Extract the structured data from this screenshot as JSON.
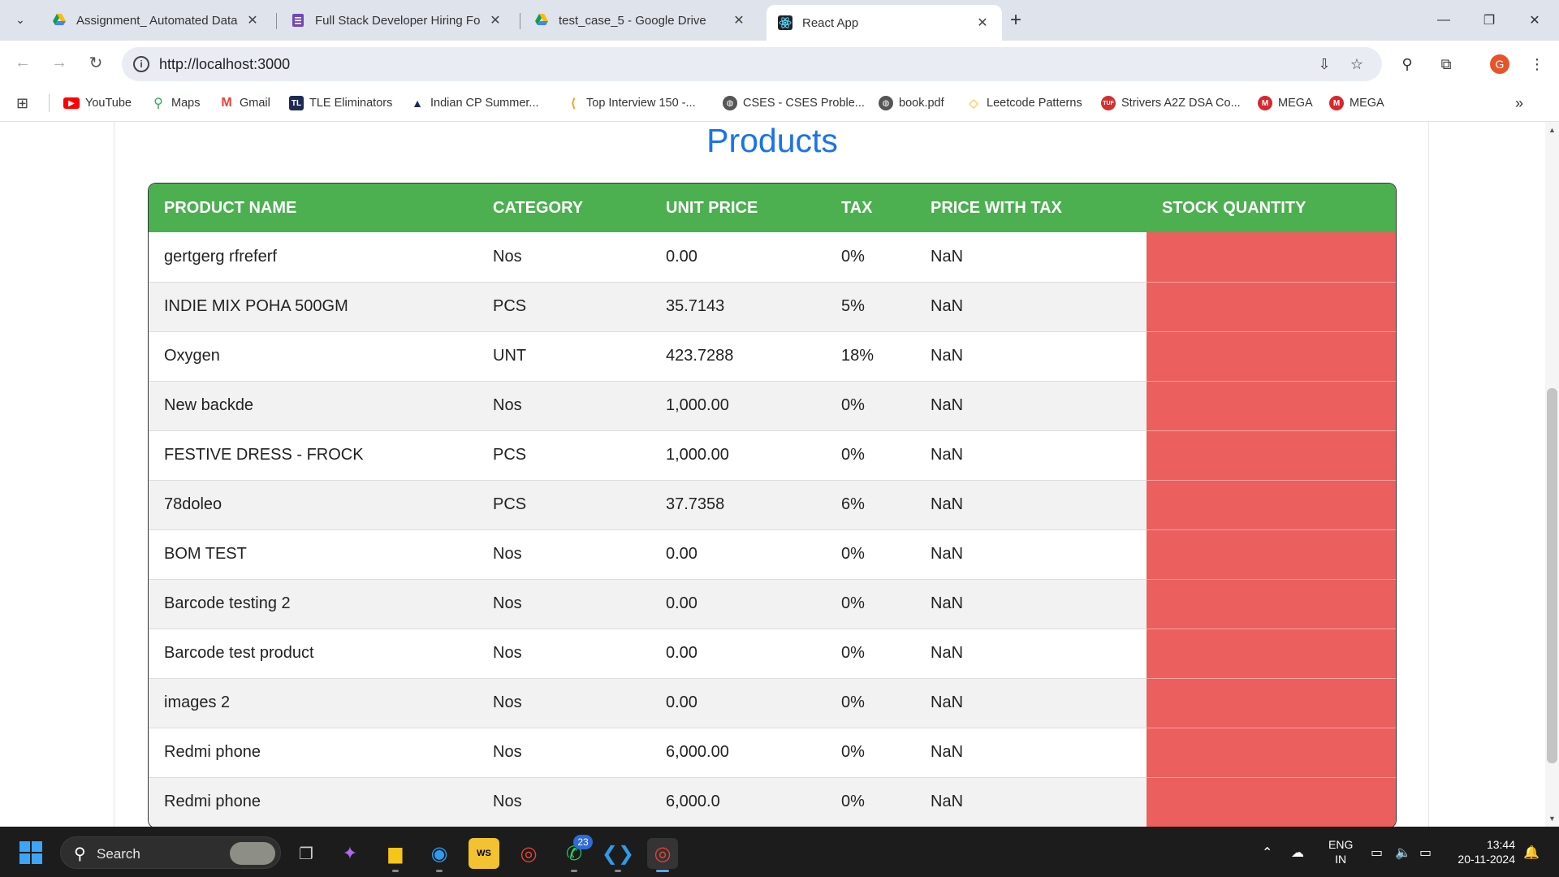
{
  "browser": {
    "tabs": [
      {
        "title": "Assignment_ Automated Data E",
        "icon": "google-drive-icon"
      },
      {
        "title": "Full Stack Developer Hiring For",
        "icon": "google-forms-icon"
      },
      {
        "title": "test_case_5 - Google Drive",
        "icon": "google-drive-icon"
      },
      {
        "title": "React App",
        "icon": "react-icon",
        "active": true
      }
    ],
    "url": "http://localhost:3000",
    "profile_initial": "G",
    "bookmarks": [
      {
        "label": "YouTube",
        "color": "#ff0000"
      },
      {
        "label": "Maps",
        "color": "#34a853"
      },
      {
        "label": "Gmail",
        "color": "#ea4335"
      },
      {
        "label": "TLE Eliminators",
        "color": "#1d2b53"
      },
      {
        "label": "Indian CP Summer...",
        "color": "#1d2b53"
      },
      {
        "label": "Top Interview 150 -...",
        "color": "#f89f1b"
      },
      {
        "label": "CSES - CSES Proble...",
        "color": "#555555"
      },
      {
        "label": "book.pdf",
        "color": "#555555"
      },
      {
        "label": "Leetcode Patterns",
        "color": "#f5b800"
      },
      {
        "label": "Strivers A2Z DSA Co...",
        "color": "#d32f2f"
      },
      {
        "label": "MEGA",
        "color": "#d9272e"
      },
      {
        "label": "MEGA",
        "color": "#d9272e"
      }
    ]
  },
  "page": {
    "title": "Products",
    "columns": [
      "PRODUCT NAME",
      "CATEGORY",
      "UNIT PRICE",
      "TAX",
      "PRICE WITH TAX",
      "STOCK QUANTITY"
    ],
    "rows": [
      {
        "name": "gertgerg rfreferf",
        "category": "Nos",
        "unit_price": "0.00",
        "tax": "0%",
        "price_with_tax": "NaN",
        "stock": ""
      },
      {
        "name": "INDIE MIX POHA 500GM",
        "category": "PCS",
        "unit_price": "35.7143",
        "tax": "5%",
        "price_with_tax": "NaN",
        "stock": ""
      },
      {
        "name": "Oxygen",
        "category": "UNT",
        "unit_price": "423.7288",
        "tax": "18%",
        "price_with_tax": "NaN",
        "stock": ""
      },
      {
        "name": "New backde",
        "category": "Nos",
        "unit_price": "1,000.00",
        "tax": "0%",
        "price_with_tax": "NaN",
        "stock": ""
      },
      {
        "name": "FESTIVE DRESS - FROCK",
        "category": "PCS",
        "unit_price": "1,000.00",
        "tax": "0%",
        "price_with_tax": "NaN",
        "stock": ""
      },
      {
        "name": "78doleo",
        "category": "PCS",
        "unit_price": "37.7358",
        "tax": "6%",
        "price_with_tax": "NaN",
        "stock": ""
      },
      {
        "name": "BOM TEST",
        "category": "Nos",
        "unit_price": "0.00",
        "tax": "0%",
        "price_with_tax": "NaN",
        "stock": ""
      },
      {
        "name": "Barcode testing 2",
        "category": "Nos",
        "unit_price": "0.00",
        "tax": "0%",
        "price_with_tax": "NaN",
        "stock": ""
      },
      {
        "name": "Barcode test product",
        "category": "Nos",
        "unit_price": "0.00",
        "tax": "0%",
        "price_with_tax": "NaN",
        "stock": ""
      },
      {
        "name": "images 2",
        "category": "Nos",
        "unit_price": "0.00",
        "tax": "0%",
        "price_with_tax": "NaN",
        "stock": ""
      },
      {
        "name": "Redmi phone",
        "category": "Nos",
        "unit_price": "6,000.00",
        "tax": "0%",
        "price_with_tax": "NaN",
        "stock": ""
      },
      {
        "name": "Redmi phone",
        "category": "Nos",
        "unit_price": "6,000.0",
        "tax": "0%",
        "price_with_tax": "NaN",
        "stock": ""
      }
    ],
    "colors": {
      "header": "#4caf50",
      "stock_low": "#ec5f5f",
      "title": "#1a73e8"
    }
  },
  "taskbar": {
    "search_label": "Search",
    "whatsapp_badge": "23",
    "lang_line1": "ENG",
    "lang_line2": "IN",
    "time": "13:44",
    "date": "20-11-2024"
  }
}
